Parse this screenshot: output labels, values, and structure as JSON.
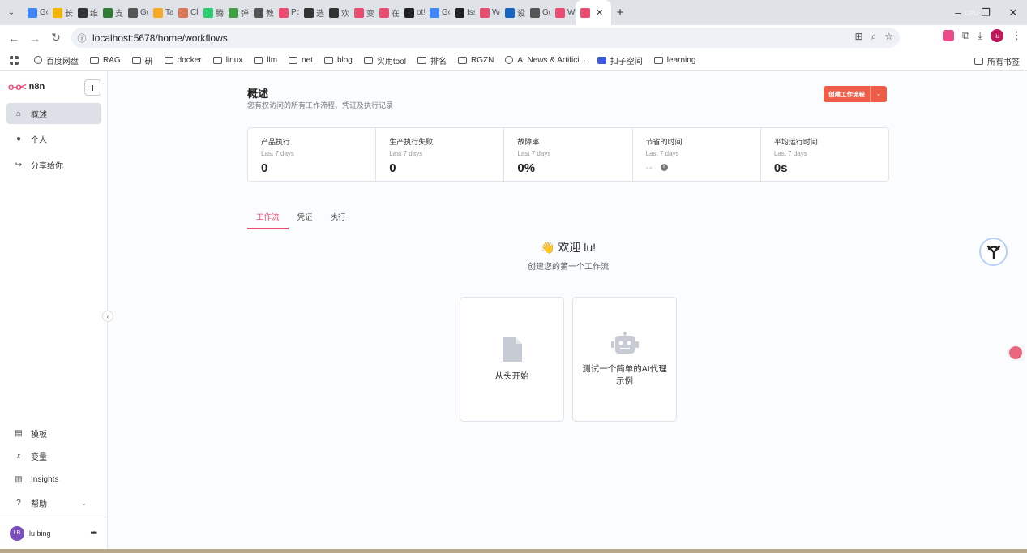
{
  "browser": {
    "tabs": [
      {
        "label": "Go",
        "color": "#4285f4"
      },
      {
        "label": "长!",
        "color": "#f4b400"
      },
      {
        "label": "维:",
        "color": "#333333"
      },
      {
        "label": "支!",
        "color": "#2e7d32"
      },
      {
        "label": "Ge",
        "color": "#555555"
      },
      {
        "label": "Tai",
        "color": "#f9a825"
      },
      {
        "label": "Cla",
        "color": "#d97757"
      },
      {
        "label": "腾!",
        "color": "#2ecc71"
      },
      {
        "label": "弹!",
        "color": "#43a047"
      },
      {
        "label": "教!",
        "color": "#555555"
      },
      {
        "label": "Po",
        "color": "#ea4b71"
      },
      {
        "label": "选!",
        "color": "#333333"
      },
      {
        "label": "欢!",
        "color": "#333333"
      },
      {
        "label": "变!",
        "color": "#ea4b71"
      },
      {
        "label": "在!",
        "color": "#ea4b71"
      },
      {
        "label": "ot!",
        "color": "#222222"
      },
      {
        "label": "Go",
        "color": "#4285f4"
      },
      {
        "label": "Iss",
        "color": "#222222"
      },
      {
        "label": "Wo",
        "color": "#ea4b71"
      },
      {
        "label": "设!",
        "color": "#1565c0"
      },
      {
        "label": "Go",
        "color": "#555555"
      },
      {
        "label": "W",
        "color": "#ea4b71"
      }
    ],
    "active_tab_close": "✕",
    "new_tab": "+",
    "cpu_overlay": "CPU",
    "url": "localhost:5678/home/workflows",
    "bookmarks": [
      {
        "label": "百度网盘",
        "icon": "baidu-icon"
      },
      {
        "label": "RAG",
        "icon": "folder-icon"
      },
      {
        "label": "研",
        "icon": "folder-icon"
      },
      {
        "label": "docker",
        "icon": "folder-icon"
      },
      {
        "label": "linux",
        "icon": "folder-icon"
      },
      {
        "label": "llm",
        "icon": "folder-icon"
      },
      {
        "label": "net",
        "icon": "folder-icon"
      },
      {
        "label": "blog",
        "icon": "folder-icon"
      },
      {
        "label": "实用tool",
        "icon": "folder-icon"
      },
      {
        "label": "排名",
        "icon": "folder-icon"
      },
      {
        "label": "RGZN",
        "icon": "folder-icon"
      },
      {
        "label": "AI News & Artifici...",
        "icon": "globe-icon"
      },
      {
        "label": "扣子空间",
        "icon": "coze-icon"
      },
      {
        "label": "learning",
        "icon": "folder-icon"
      }
    ],
    "all_bookmarks": "所有书签",
    "profile_initials": "lu"
  },
  "sidebar": {
    "brand": "n8n",
    "items": [
      {
        "label": "概述",
        "icon": "home-icon",
        "active": true
      },
      {
        "label": "个人",
        "icon": "user-icon",
        "active": false
      },
      {
        "label": "分享给你",
        "icon": "share-icon",
        "active": false
      }
    ],
    "bottom_items": [
      {
        "label": "模板",
        "icon": "box-icon"
      },
      {
        "label": "变量",
        "icon": "variable-icon"
      },
      {
        "label": "Insights",
        "icon": "chart-icon"
      },
      {
        "label": "帮助",
        "icon": "help-icon"
      }
    ],
    "user": {
      "initials": "LB",
      "name": "lu bing"
    }
  },
  "main": {
    "title": "概述",
    "subtitle": "您有权访问的所有工作流程、凭证及执行记录",
    "create_button": "创建工作流程",
    "stats": [
      {
        "label": "产品执行",
        "period": "Last 7 days",
        "value": "0"
      },
      {
        "label": "生产执行失败",
        "period": "Last 7 days",
        "value": "0"
      },
      {
        "label": "故障率",
        "period": "Last 7 days",
        "value": "0%"
      },
      {
        "label": "节省的时间",
        "period": "Last 7 days",
        "value": "--"
      },
      {
        "label": "平均运行时间",
        "period": "Last 7 days",
        "value": "0s"
      }
    ],
    "tabs": [
      {
        "label": "工作流",
        "active": true
      },
      {
        "label": "凭证",
        "active": false
      },
      {
        "label": "执行",
        "active": false
      }
    ],
    "welcome": "👋 欢迎 lu!",
    "welcome_sub": "创建您的第一个工作流",
    "cards": [
      {
        "label": "从头开始",
        "icon": "file-icon"
      },
      {
        "label": "测试一个简单的AI代理示例",
        "icon": "robot-icon"
      }
    ]
  }
}
